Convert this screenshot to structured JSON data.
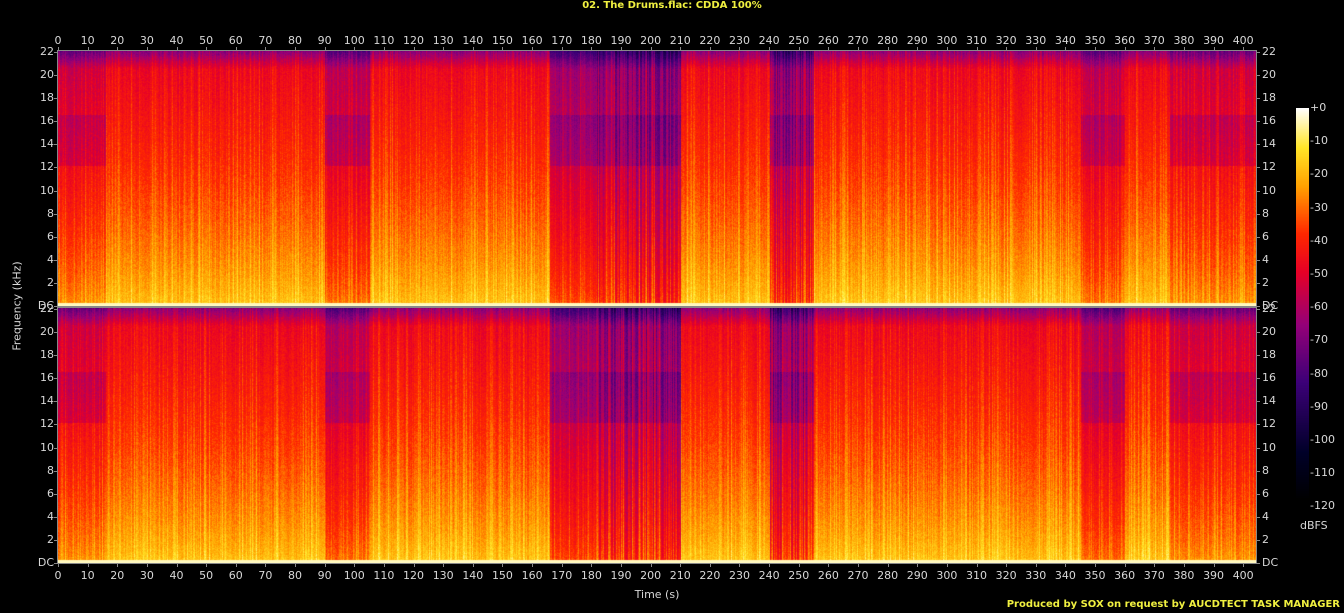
{
  "title": "02. The Drums.flac: CDDA 100%",
  "footer": "Produced by SOX on request by AUCDTECT TASK MANAGER",
  "chart_data": {
    "type": "heatmap",
    "subtype": "spectrogram",
    "channels": 2,
    "xlabel": "Time (s)",
    "ylabel": "Frequency (kHz)",
    "xlim": [
      0,
      405
    ],
    "ylim": [
      0,
      22.05
    ],
    "x_ticks": [
      0,
      10,
      20,
      30,
      40,
      50,
      60,
      70,
      80,
      90,
      100,
      110,
      120,
      130,
      140,
      150,
      160,
      170,
      180,
      190,
      200,
      210,
      220,
      230,
      240,
      250,
      260,
      270,
      280,
      290,
      300,
      310,
      320,
      330,
      340,
      350,
      360,
      370,
      380,
      390,
      400
    ],
    "y_ticks": [
      "DC",
      "2",
      "4",
      "6",
      "8",
      "10",
      "12",
      "14",
      "16",
      "18",
      "20",
      "22"
    ],
    "colorbar": {
      "label": "dBFS",
      "range": [
        -120,
        0
      ],
      "ticks": [
        "+0",
        "-10",
        "-20",
        "-30",
        "-40",
        "-50",
        "-60",
        "-70",
        "-80",
        "-90",
        "-100",
        "-110",
        "-120"
      ]
    },
    "segments_estimated": [
      {
        "start": 0,
        "end": 16,
        "level": "moderate"
      },
      {
        "start": 16,
        "end": 90,
        "level": "loud"
      },
      {
        "start": 90,
        "end": 105,
        "level": "quieter"
      },
      {
        "start": 105,
        "end": 166,
        "level": "loud"
      },
      {
        "start": 166,
        "end": 181,
        "level": "quiet"
      },
      {
        "start": 181,
        "end": 210,
        "level": "sparse"
      },
      {
        "start": 210,
        "end": 240,
        "level": "loud"
      },
      {
        "start": 240,
        "end": 255,
        "level": "sparse"
      },
      {
        "start": 255,
        "end": 345,
        "level": "loud"
      },
      {
        "start": 345,
        "end": 360,
        "level": "quieter"
      },
      {
        "start": 360,
        "end": 375,
        "level": "loud"
      },
      {
        "start": 375,
        "end": 405,
        "level": "moderate"
      }
    ]
  }
}
